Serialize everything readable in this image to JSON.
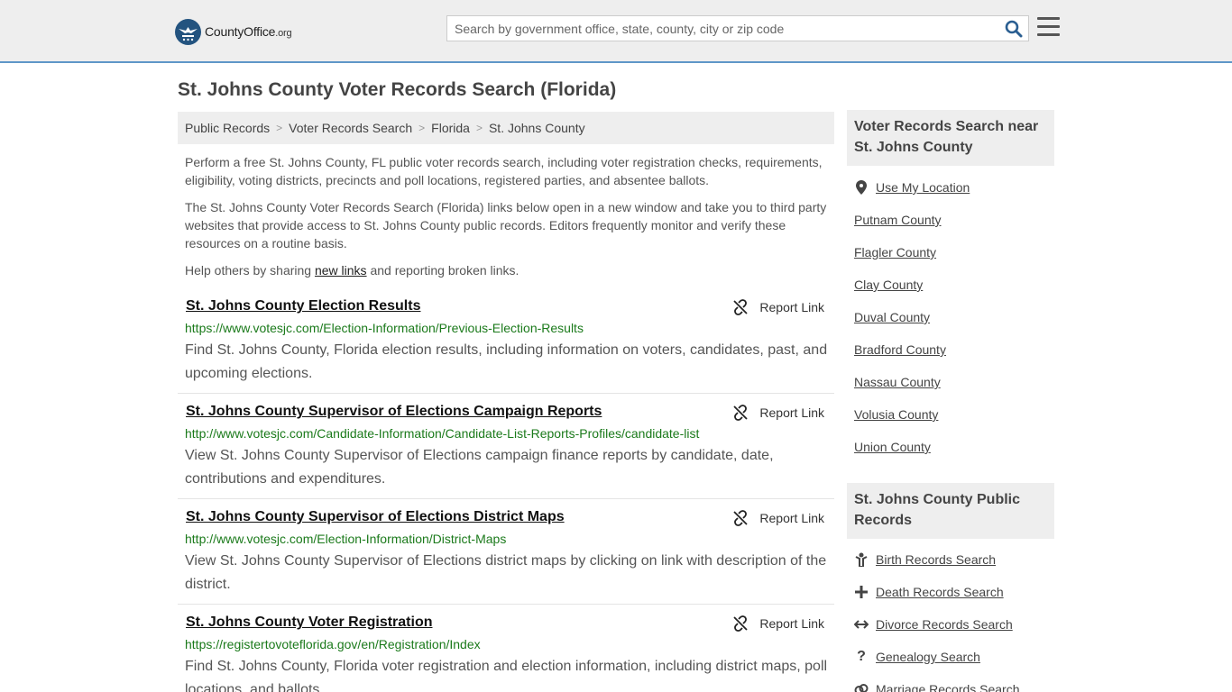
{
  "header": {
    "logo_name": "CountyOffice",
    "logo_tld": ".org",
    "search_placeholder": "Search by government office, state, county, city or zip code"
  },
  "page": {
    "title": "St. Johns County Voter Records Search (Florida)"
  },
  "breadcrumb": [
    "Public Records",
    "Voter Records Search",
    "Florida",
    "St. Johns County"
  ],
  "intro": {
    "p1": "Perform a free St. Johns County, FL public voter records search, including voter registration checks, requirements, eligibility, voting districts, precincts and poll locations, registered parties, and absentee ballots.",
    "p2": "The St. Johns County Voter Records Search (Florida) links below open in a new window and take you to third party websites that provide access to St. Johns County public records. Editors frequently monitor and verify these resources on a routine basis.",
    "p3_before": "Help others by sharing ",
    "p3_link": "new links",
    "p3_after": " and reporting broken links."
  },
  "report_label": "Report Link",
  "results": [
    {
      "title": "St. Johns County Election Results",
      "url": "https://www.votesjc.com/Election-Information/Previous-Election-Results",
      "desc": "Find St. Johns County, Florida election results, including information on voters, candidates, past, and upcoming elections."
    },
    {
      "title": "St. Johns County Supervisor of Elections Campaign Reports",
      "url": "http://www.votesjc.com/Candidate-Information/Candidate-List-Reports-Profiles/candidate-list",
      "desc": "View St. Johns County Supervisor of Elections campaign finance reports by candidate, date, contributions and expenditures."
    },
    {
      "title": "St. Johns County Supervisor of Elections District Maps",
      "url": "http://www.votesjc.com/Election-Information/District-Maps",
      "desc": "View St. Johns County Supervisor of Elections district maps by clicking on link with description of the district."
    },
    {
      "title": "St. Johns County Voter Registration",
      "url": "https://registertovoteflorida.gov/en/Registration/Index",
      "desc": "Find St. Johns County, Florida voter registration and election information, including district maps, poll locations, and ballots."
    }
  ],
  "sidebar": {
    "nearby_heading": "Voter Records Search near St. Johns County",
    "use_location": "Use My Location",
    "nearby": [
      "Putnam County",
      "Flagler County",
      "Clay County",
      "Duval County",
      "Bradford County",
      "Nassau County",
      "Volusia County",
      "Union County"
    ],
    "records_heading": "St. Johns County Public Records",
    "records": [
      {
        "label": "Birth Records Search",
        "icon": "child-icon"
      },
      {
        "label": "Death Records Search",
        "icon": "cross-icon"
      },
      {
        "label": "Divorce Records Search",
        "icon": "split-arrows-icon"
      },
      {
        "label": "Genealogy Search",
        "icon": "question-icon"
      },
      {
        "label": "Marriage Records Search",
        "icon": "rings-icon"
      }
    ]
  }
}
